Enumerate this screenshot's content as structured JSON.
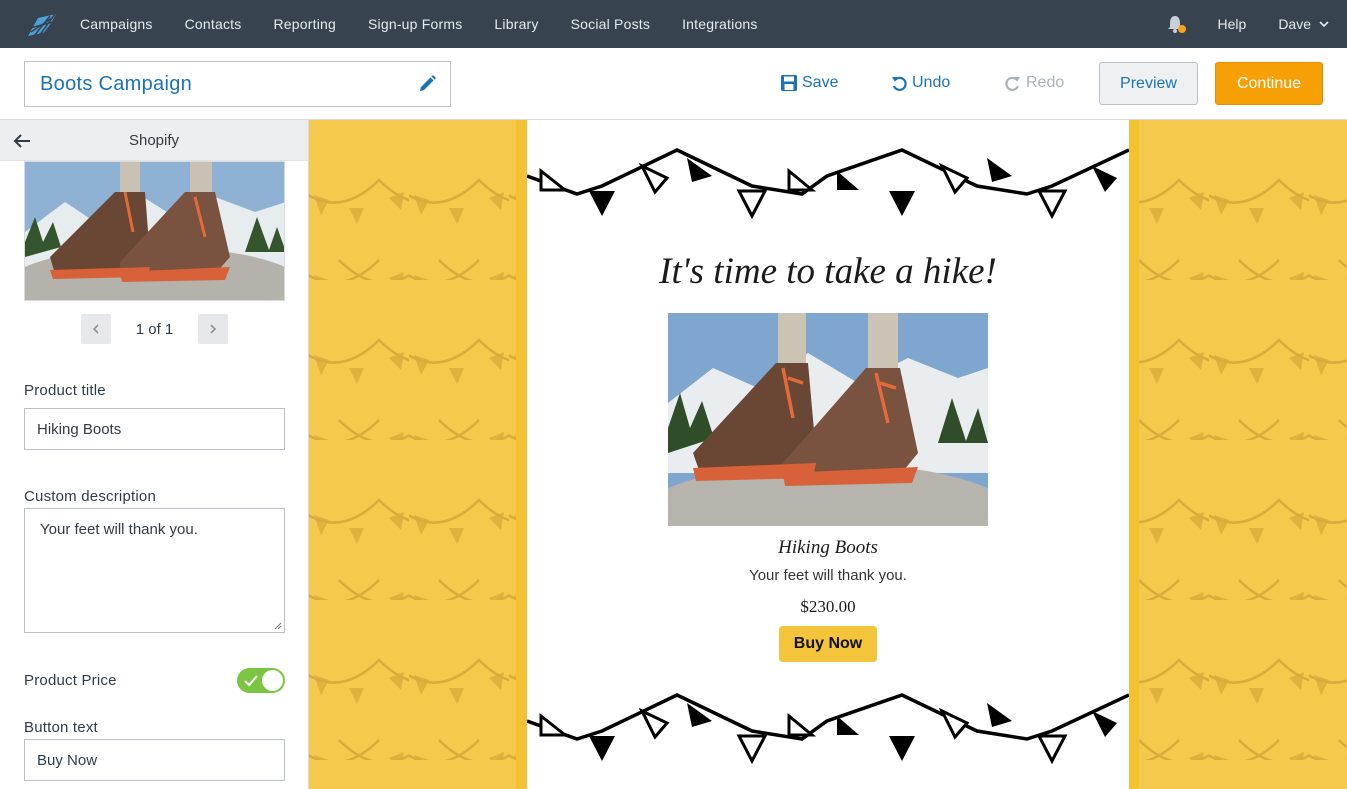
{
  "nav": {
    "items": [
      "Campaigns",
      "Contacts",
      "Reporting",
      "Sign-up Forms",
      "Library",
      "Social Posts",
      "Integrations"
    ],
    "help": "Help",
    "user": "Dave",
    "notification_dot_color": "#f7a21b"
  },
  "toolbar": {
    "campaign_name": "Boots Campaign",
    "save": "Save",
    "undo": "Undo",
    "redo": "Redo",
    "preview": "Preview",
    "continue": "Continue"
  },
  "panel": {
    "title": "Shopify",
    "pager": "1 of 1",
    "product_title_label": "Product title",
    "product_title_value": "Hiking Boots",
    "description_label": "Custom description",
    "description_value": "Your feet will thank you.",
    "price_label": "Product Price",
    "price_toggle_on": true,
    "button_text_label": "Button text",
    "button_text_value": "Buy Now"
  },
  "email": {
    "headline": "It's time to take a hike!",
    "product_title": "Hiking Boots",
    "product_description": "Your feet will thank you.",
    "price": "$230.00",
    "button": "Buy Now"
  },
  "colors": {
    "nav_bg": "#37444f",
    "link_blue": "#1a73b5",
    "continue_orange": "#f7a006",
    "canvas_yellow": "#f5c94b",
    "toggle_green": "#7bc543"
  }
}
